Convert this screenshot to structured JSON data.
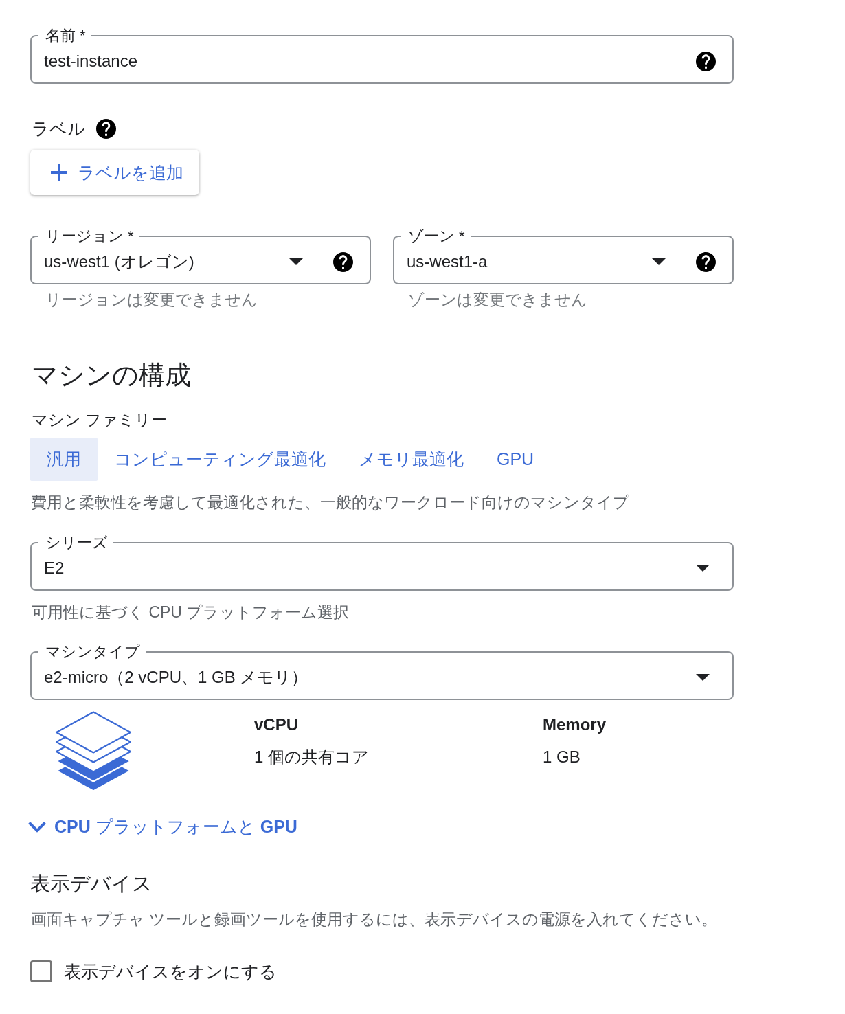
{
  "name_field": {
    "kind": "text",
    "label": "名前 *",
    "value": "test-instance",
    "help": true
  },
  "labels": {
    "title": "ラベル",
    "help": true,
    "add_button": "ラベルを追加"
  },
  "location": [
    {
      "kind": "select",
      "label": "リージョン *",
      "value": "us-west1 (オレゴン)",
      "help": true,
      "hint": "リージョンは変更できません"
    },
    {
      "kind": "select",
      "label": "ゾーン *",
      "value": "us-west1-a",
      "help": true,
      "hint": "ゾーンは変更できません"
    }
  ],
  "machine_config": {
    "title": "マシンの構成",
    "family_label": "マシン ファミリー",
    "families": [
      {
        "label": "汎用",
        "selected": true
      },
      {
        "label": "コンピューティング最適化",
        "selected": false
      },
      {
        "label": "メモリ最適化",
        "selected": false
      },
      {
        "label": "GPU",
        "selected": false
      }
    ],
    "description": "費用と柔軟性を考慮して最適化された、一般的なワークロード向けのマシンタイプ",
    "series": {
      "kind": "select",
      "label": "シリーズ",
      "value": "E2",
      "hint": "可用性に基づく CPU プラットフォーム選択"
    },
    "machine_type": {
      "kind": "select",
      "label": "マシンタイプ",
      "value": "e2-micro（2 vCPU、1 GB メモリ）"
    },
    "specs": [
      {
        "label": "vCPU",
        "value": "1 個の共有コア"
      },
      {
        "label": "Memory",
        "value": "1 GB"
      }
    ],
    "advanced_toggle": {
      "label": "**CPU** プラットフォームと **GPU**",
      "expanded": false
    }
  },
  "display_device": {
    "title": "表示デバイス",
    "description": "画面キャプチャ ツールと録画ツールを使用するには、表示デバイスの電源を入れてください。",
    "checkbox": {
      "label": "表示デバイスをオンにする",
      "checked": false
    }
  }
}
